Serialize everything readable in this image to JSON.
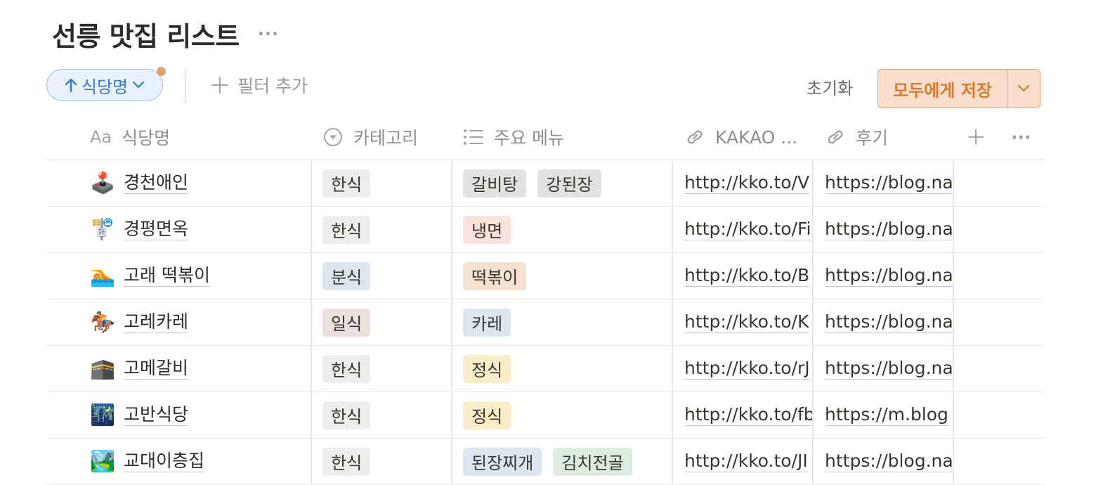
{
  "page": {
    "title": "선릉 맛집 리스트",
    "more": "···"
  },
  "toolbar": {
    "sort_label": "식당명",
    "add_filter": "필터 추가",
    "reset": "초기화",
    "save": "모두에게 저장"
  },
  "columns": {
    "name": {
      "icon": "Aa",
      "label": "식당명"
    },
    "category": "카테고리",
    "menu": "주요 메뉴",
    "kakao": "KAKAO ...",
    "review": "후기",
    "more": "···"
  },
  "tag_colors": {
    "gray": "#ededeb",
    "blue": "#dbe6ee",
    "brown": "#ebe0db",
    "red": "#fbe0dc",
    "orange": "#f6e0d0",
    "yellow": "#fbecc8",
    "green": "#dcecde",
    "darkgray": "#e3e2e0"
  },
  "rows": [
    {
      "emoji": "🕹️",
      "name": "경천애인",
      "category": {
        "label": "한식",
        "color": "gray"
      },
      "menu": [
        {
          "label": "갈비탕",
          "color": "darkgray"
        },
        {
          "label": "강된장",
          "color": "darkgray"
        }
      ],
      "kakao": "http://kko.to/V",
      "review": "https://blog.na"
    },
    {
      "emoji": "🚏",
      "name": "경평면옥",
      "category": {
        "label": "한식",
        "color": "gray"
      },
      "menu": [
        {
          "label": "냉면",
          "color": "red"
        }
      ],
      "kakao": "http://kko.to/Fi",
      "review": "https://blog.na"
    },
    {
      "emoji": "🏊",
      "name": "고래 떡볶이",
      "category": {
        "label": "분식",
        "color": "blue"
      },
      "menu": [
        {
          "label": "떡볶이",
          "color": "orange"
        }
      ],
      "kakao": "http://kko.to/B",
      "review": "https://blog.na"
    },
    {
      "emoji": "🏇",
      "name": "고레카레",
      "category": {
        "label": "일식",
        "color": "brown"
      },
      "menu": [
        {
          "label": "카레",
          "color": "blue"
        }
      ],
      "kakao": "http://kko.to/K",
      "review": "https://blog.na"
    },
    {
      "emoji": "🕋",
      "name": "고메갈비",
      "category": {
        "label": "한식",
        "color": "gray"
      },
      "menu": [
        {
          "label": "정식",
          "color": "yellow"
        }
      ],
      "kakao": "http://kko.to/rJ",
      "review": "https://blog.na"
    },
    {
      "emoji": "🌃",
      "name": "고반식당",
      "category": {
        "label": "한식",
        "color": "gray"
      },
      "menu": [
        {
          "label": "정식",
          "color": "yellow"
        }
      ],
      "kakao": "http://kko.to/fb",
      "review": "https://m.blog"
    },
    {
      "emoji": "🏞️",
      "name": "교대이층집",
      "category": {
        "label": "한식",
        "color": "gray"
      },
      "menu": [
        {
          "label": "된장찌개",
          "color": "blue"
        },
        {
          "label": "김치전골",
          "color": "green"
        }
      ],
      "kakao": "http://kko.to/JI",
      "review": "https://blog.na"
    }
  ]
}
